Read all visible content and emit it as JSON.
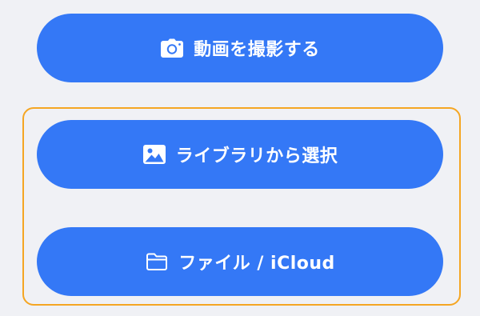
{
  "buttons": {
    "camera": {
      "label": "動画を撮影する",
      "icon": "camera-icon"
    },
    "library": {
      "label": "ライブラリから選択",
      "icon": "photo-icon"
    },
    "file": {
      "label": "ファイル / iCloud",
      "icon": "folder-icon"
    }
  },
  "colors": {
    "background": "#f0f1f5",
    "button": "#3478f6",
    "button_text": "#ffffff",
    "highlight_border": "#f5a623"
  }
}
